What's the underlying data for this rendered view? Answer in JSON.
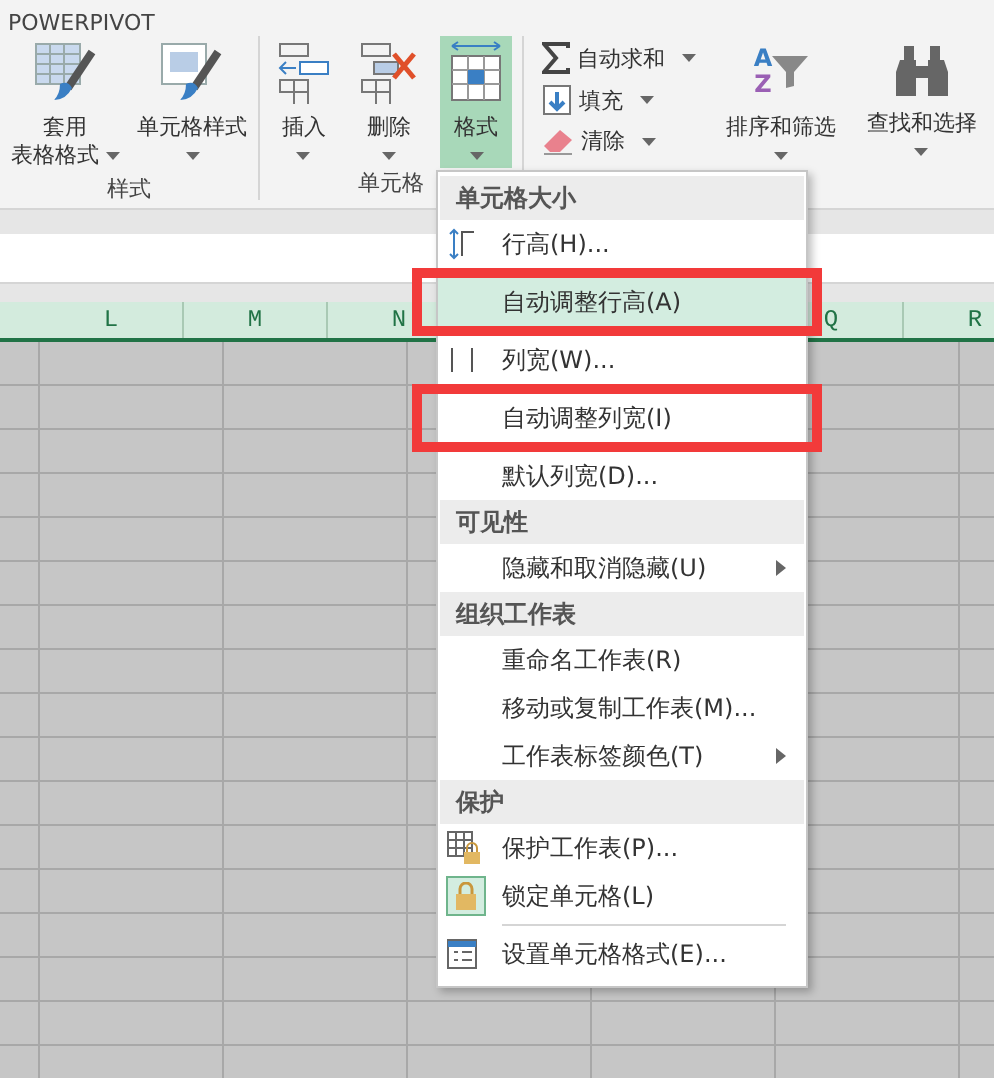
{
  "ribbon_tab": "POWERPIVOT",
  "ribbon_groups": [
    {
      "label": "样式",
      "buttons": [
        {
          "kind": "tablestyle",
          "lines": [
            "套用",
            "表格格式"
          ],
          "dropdown": true,
          "selected": false
        },
        {
          "kind": "cellstyle",
          "lines": [
            "单元格样式"
          ],
          "dropdown": true,
          "selected": false
        }
      ]
    },
    {
      "label": "单元格",
      "buttons": [
        {
          "kind": "insert",
          "lines": [
            "插入"
          ],
          "dropdown": true,
          "selected": false
        },
        {
          "kind": "delete",
          "lines": [
            "删除"
          ],
          "dropdown": true,
          "selected": false
        },
        {
          "kind": "format",
          "lines": [
            "格式"
          ],
          "dropdown": true,
          "selected": true
        }
      ]
    },
    {
      "small_buttons": [
        {
          "kind": "sum",
          "label": "自动求和",
          "dropdown": true
        },
        {
          "kind": "fill",
          "label": "填充",
          "dropdown": true
        },
        {
          "kind": "clear",
          "label": "清除",
          "dropdown": true
        }
      ],
      "buttons": [
        {
          "kind": "sort",
          "icon_letters": [
            "A",
            "Z"
          ],
          "lines": [
            "排序和筛选"
          ],
          "dropdown": true,
          "selected": false
        },
        {
          "kind": "find",
          "lines": [
            "查找和选择"
          ],
          "dropdown": true,
          "selected": false
        }
      ]
    }
  ],
  "columns": [
    {
      "label": "L"
    },
    {
      "label": "M"
    },
    {
      "label": "N"
    },
    {
      "label": "Q"
    },
    {
      "label": "R"
    }
  ],
  "menu": [
    {
      "kind": "header",
      "label": "单元格大小"
    },
    {
      "kind": "rowheight",
      "label": "行高(H)...",
      "selected": false,
      "submenu": false,
      "highlighted": false
    },
    {
      "kind": "plain",
      "label": "自动调整行高(A)",
      "selected": true,
      "submenu": false,
      "highlighted": true
    },
    {
      "kind": "colwidth",
      "label": "列宽(W)...",
      "selected": false,
      "submenu": false,
      "highlighted": false
    },
    {
      "kind": "plain",
      "label": "自动调整列宽(I)",
      "selected": false,
      "submenu": false,
      "highlighted": true
    },
    {
      "kind": "plain",
      "label": "默认列宽(D)...",
      "selected": false,
      "submenu": false,
      "highlighted": false
    },
    {
      "kind": "header",
      "label": "可见性"
    },
    {
      "kind": "plain",
      "label": "隐藏和取消隐藏(U)",
      "selected": false,
      "submenu": true,
      "highlighted": false
    },
    {
      "kind": "header",
      "label": "组织工作表"
    },
    {
      "kind": "plain",
      "label": "重命名工作表(R)",
      "selected": false,
      "submenu": false,
      "highlighted": false
    },
    {
      "kind": "plain",
      "label": "移动或复制工作表(M)...",
      "selected": false,
      "submenu": false,
      "highlighted": false
    },
    {
      "kind": "plain",
      "label": "工作表标签颜色(T)",
      "selected": false,
      "submenu": true,
      "highlighted": false
    },
    {
      "kind": "header",
      "label": "保护"
    },
    {
      "kind": "protect",
      "label": "保护工作表(P)...",
      "selected": false,
      "submenu": false,
      "highlighted": false
    },
    {
      "kind": "lock",
      "label": "锁定单元格(L)",
      "selected": false,
      "submenu": false,
      "highlighted": false,
      "checked": true
    },
    {
      "kind": "separator"
    },
    {
      "kind": "cellformat",
      "label": "设置单元格格式(E)...",
      "selected": false,
      "submenu": false,
      "highlighted": false
    }
  ]
}
